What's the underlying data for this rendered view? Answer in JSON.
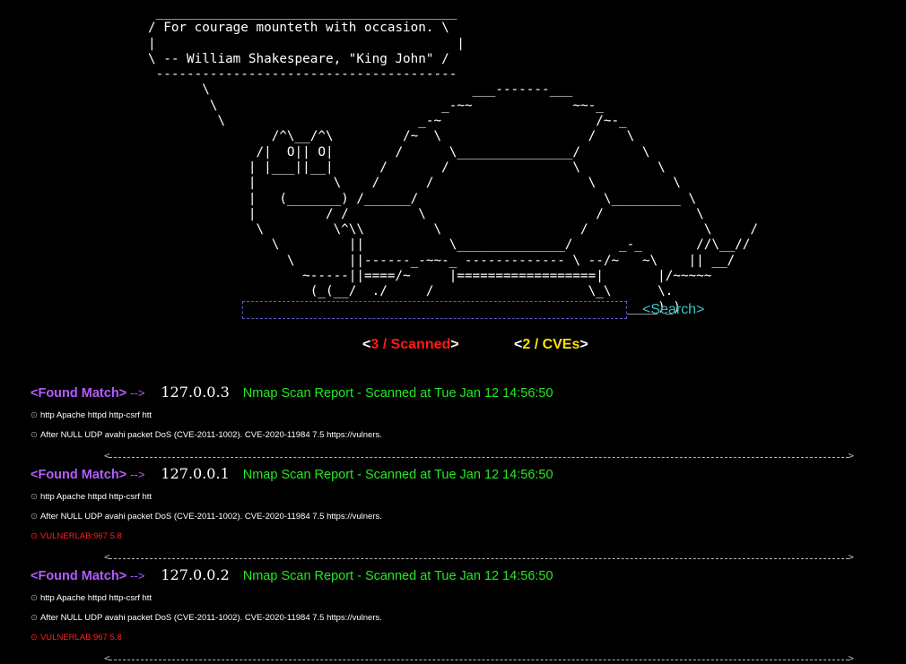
{
  "banner": {
    "ascii": " _______________________________________\n/ For courage mounteth with occasion. \\\n|                                       |\n\\ -- William Shakespeare, \"King John\" /\n ---------------------------------------\n       \\                                  ___-------___\n        \\                             _-~~             ~~-_\n         \\                         _-~                    /~-_\n                /^\\__/^\\         /~  \\                   /    \\\n              /|  O|| O|        /      \\_______________/        \\\n             | |___||__|      /       /                \\          \\\n             |          \\    /      /                    \\          \\\n             |   (_______) /______/                        \\_________ \\\n             |         / /         \\                      /            \\\n              \\         \\^\\\\         \\                  /               \\     /\n                \\         ||           \\______________/      _-_       //\\__//\n                  \\       ||------_-~~-_ ------------- \\ --/~   ~\\    || __/\n                    ~-----||====/~     |==================|       |/~~~~~\n                     (_(__/  ./     /                    \\_\\      \\.\n                            (_(___/                         \\_____)_)"
  },
  "search": {
    "placeholder": "",
    "value": "",
    "button_label": "<Search>"
  },
  "counters": {
    "scanned_open": "<",
    "scanned_text": "3 / Scanned",
    "scanned_close": ">",
    "cves_open": "<",
    "cves_text": "2 / CVEs",
    "cves_close": ">"
  },
  "results": [
    {
      "label": "<Found Match>",
      "arrow": "-->",
      "ip": "127.0.0.3",
      "report": "Nmap Scan Report - Scanned at Tue Jan 12 14:56:50",
      "details": [
        "http  Apache httpd  http-csrf  htt",
        "After NULL UDP avahi packet DoS (CVE-2011-1002). CVE-2020-11984 7.5 https://vulners."
      ],
      "vuln": ""
    },
    {
      "label": "<Found Match>",
      "arrow": "-->",
      "ip": "127.0.0.1",
      "report": "Nmap Scan Report - Scanned at Tue Jan 12 14:56:50",
      "details": [
        "http  Apache httpd  http-csrf  htt",
        "After NULL UDP avahi packet DoS (CVE-2011-1002). CVE-2020-11984 7.5 https://vulners."
      ],
      "vuln": "VULNERLAB:967 5.8"
    },
    {
      "label": "<Found Match>",
      "arrow": "-->",
      "ip": "127.0.0.2",
      "report": "Nmap Scan Report - Scanned at Tue Jan 12 14:56:50",
      "details": [
        "http  Apache httpd  http-csrf  htt",
        "After NULL UDP avahi packet DoS (CVE-2011-1002). CVE-2020-11984 7.5 https://vulners."
      ],
      "vuln": "VULNERLAB:967 5.8"
    }
  ],
  "bullet_symbol": "⊙",
  "separator": {
    "left": "<",
    "right": ">"
  },
  "colors": {
    "background": "#000000",
    "found_match": "#b45cff",
    "report": "#23e823",
    "scanned": "#ff1a1a",
    "cves": "#ffe000",
    "search": "#37c8c8",
    "vuln": "#ff2020"
  }
}
